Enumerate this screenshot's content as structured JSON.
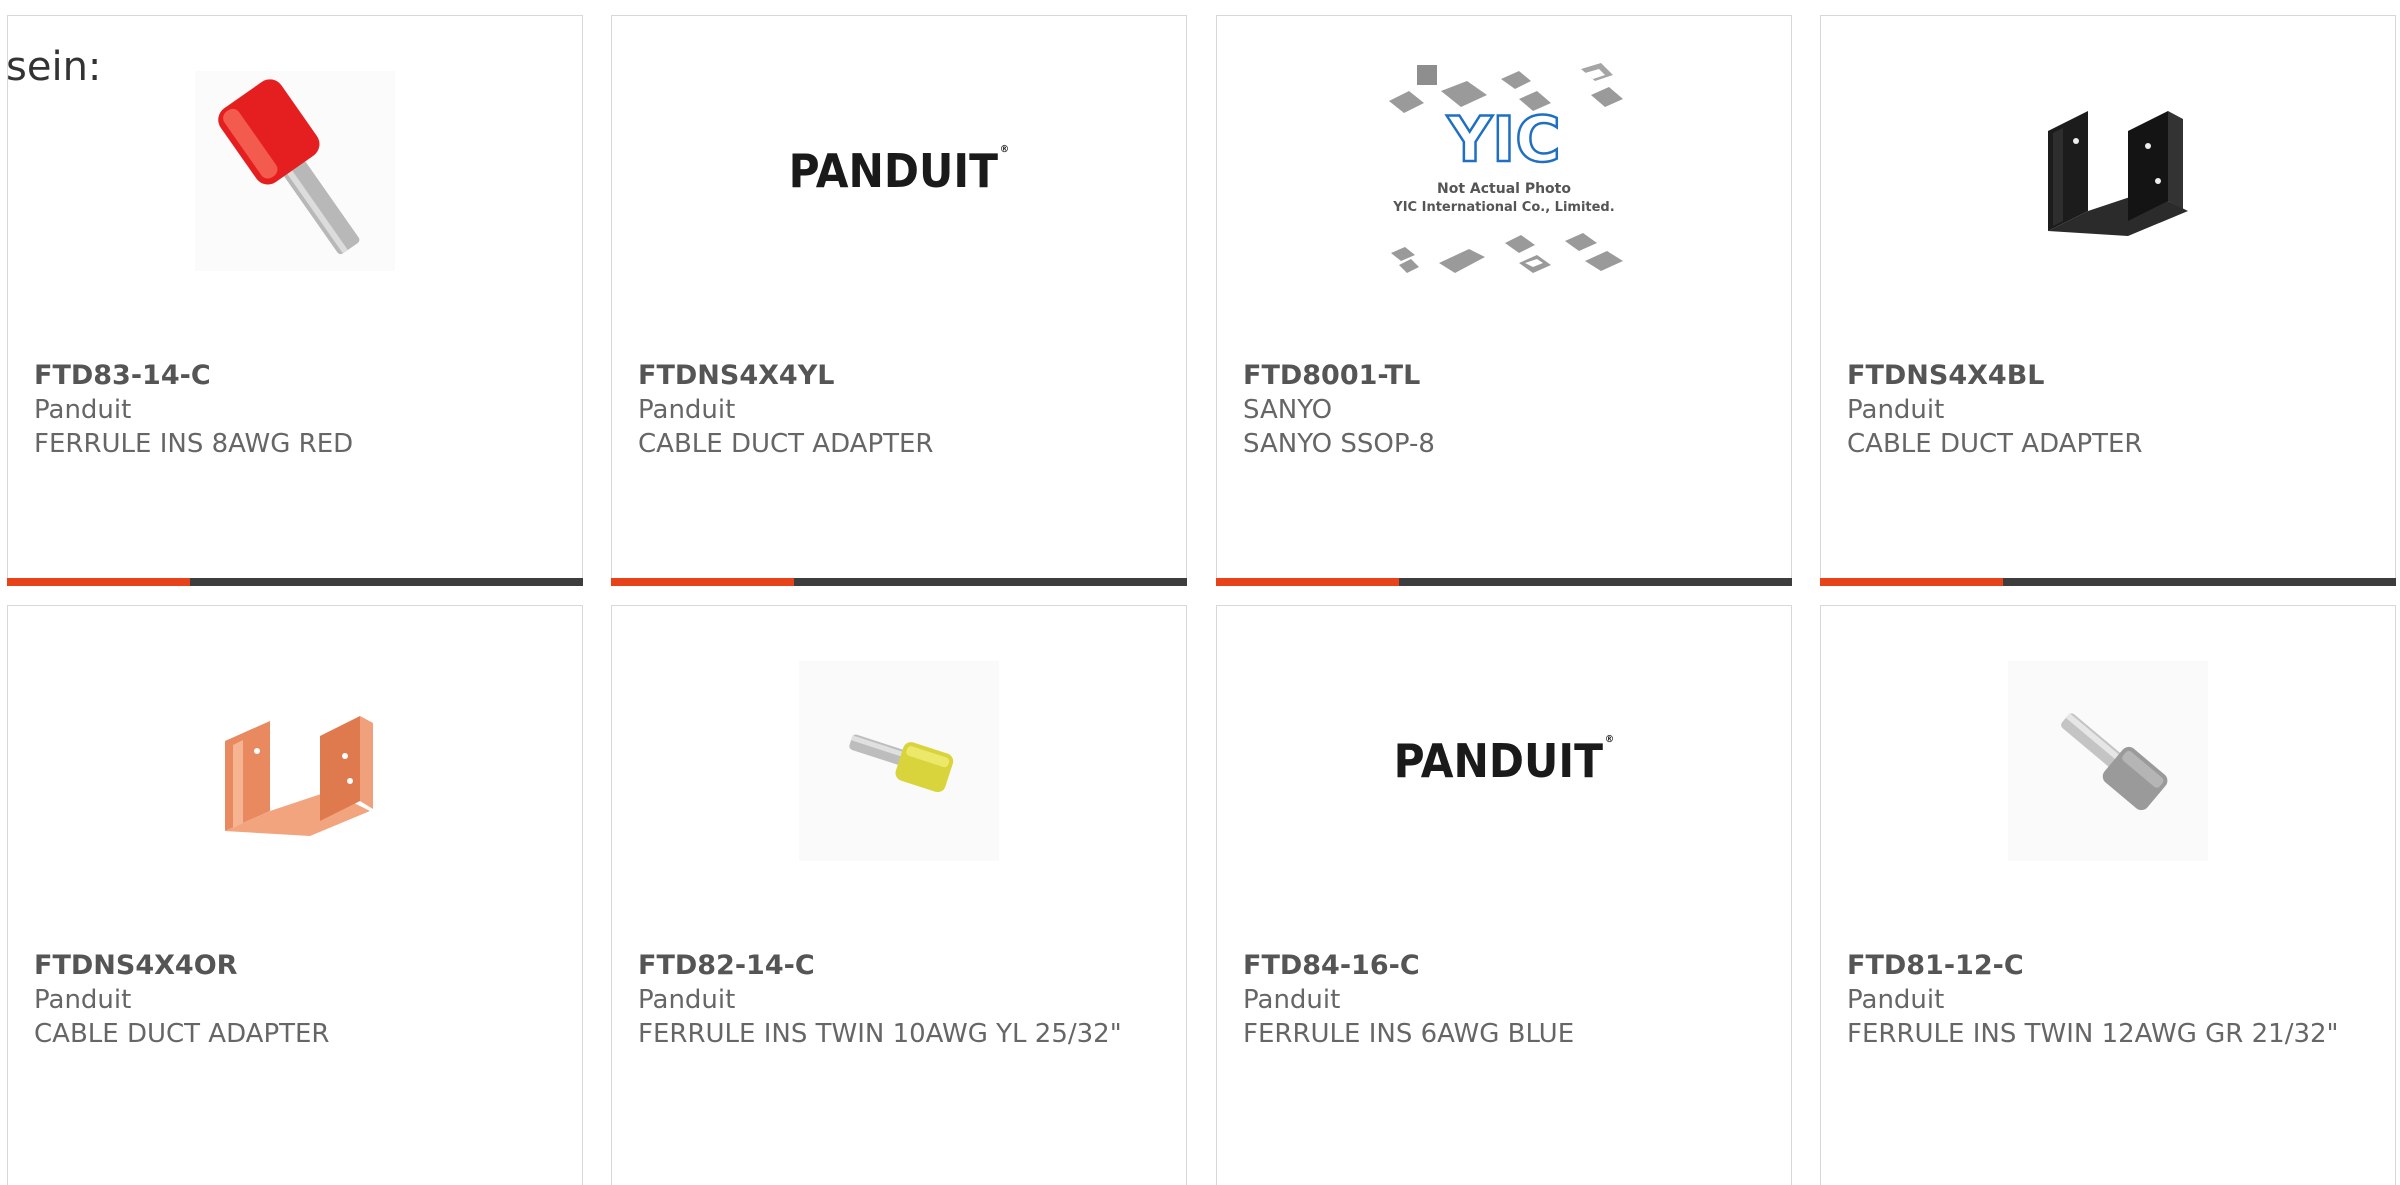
{
  "leadin_text": "sein:",
  "products": [
    {
      "part": "FTD83-14-C",
      "manufacturer": "Panduit",
      "description": "FERRULE INS 8AWG RED",
      "image": "red-ferrule-icon"
    },
    {
      "part": "FTDNS4X4YL",
      "manufacturer": "Panduit",
      "description": "CABLE DUCT ADAPTER",
      "image": "panduit-logo",
      "logo_text": "PANDUIT"
    },
    {
      "part": "FTD8001-TL",
      "manufacturer": "SANYO",
      "description": "SANYO SSOP-8",
      "image": "yic-placeholder",
      "placeholder": {
        "brand": "YIC",
        "line1": "Not Actual Photo",
        "line2": "YIC International Co., Limited."
      }
    },
    {
      "part": "FTDNS4X4BL",
      "manufacturer": "Panduit",
      "description": "CABLE DUCT ADAPTER",
      "image": "black-duct-adapter-icon"
    },
    {
      "part": "FTDNS4X4OR",
      "manufacturer": "Panduit",
      "description": "CABLE DUCT ADAPTER",
      "image": "orange-duct-adapter-icon"
    },
    {
      "part": "FTD82-14-C",
      "manufacturer": "Panduit",
      "description": "FERRULE INS TWIN 10AWG YL 25/32\"",
      "image": "yellow-twin-ferrule-icon"
    },
    {
      "part": "FTD84-16-C",
      "manufacturer": "Panduit",
      "description": "FERRULE INS 6AWG BLUE",
      "image": "panduit-logo",
      "logo_text": "PANDUIT"
    },
    {
      "part": "FTD81-12-C",
      "manufacturer": "Panduit",
      "description": "FERRULE INS TWIN 12AWG GR 21/32\"",
      "image": "gray-twin-ferrule-icon"
    }
  ],
  "colors": {
    "accent": "#e8421a",
    "bar": "#3d3d3d",
    "border": "#d8d8d8"
  }
}
